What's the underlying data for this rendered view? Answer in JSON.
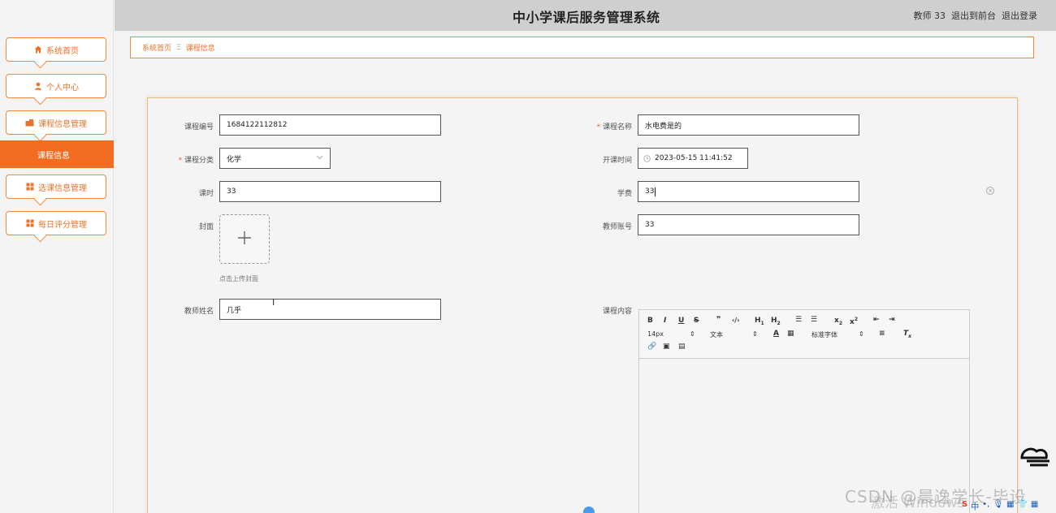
{
  "header": {
    "title": "中小学课后服务管理系统",
    "user": "教师 33",
    "front_link": "退出到前台",
    "logout_link": "退出登录"
  },
  "sidebar": {
    "items": [
      {
        "label": "系统首页",
        "icon": "home-icon"
      },
      {
        "label": "个人中心",
        "icon": "user-icon"
      },
      {
        "label": "课程信息管理",
        "icon": "folder-icon"
      },
      {
        "label": "选课信息管理",
        "icon": "grid-icon"
      },
      {
        "label": "每日评分管理",
        "icon": "grid-icon"
      }
    ],
    "active_sub": "课程信息"
  },
  "breadcrumb": {
    "home": "系统首页",
    "sep": "Ξ",
    "current": "课程信息"
  },
  "form": {
    "course_no_label": "课程编号",
    "course_no": "1684122112812",
    "course_name_label": "课程名称",
    "course_name": "水电费是的",
    "category_label": "课程分类",
    "category": "化学",
    "start_time_label": "开课时间",
    "start_time": "2023-05-15 11:41:52",
    "hours_label": "课时",
    "hours": "33",
    "fee_label": "学费",
    "fee": "33",
    "cover_label": "封面",
    "cover_tip": "点击上传封面",
    "teacher_account_label": "教师账号",
    "teacher_account": "33",
    "teacher_name_label": "教师姓名",
    "teacher_name": "几乎",
    "content_label": "课程内容"
  },
  "editor": {
    "font_size": "14px",
    "text_style": "文本",
    "font_family": "标准字体"
  },
  "overlay": {
    "watermark": "CSDN @晨逸学长-毕设",
    "activate": "激活 Windows"
  }
}
